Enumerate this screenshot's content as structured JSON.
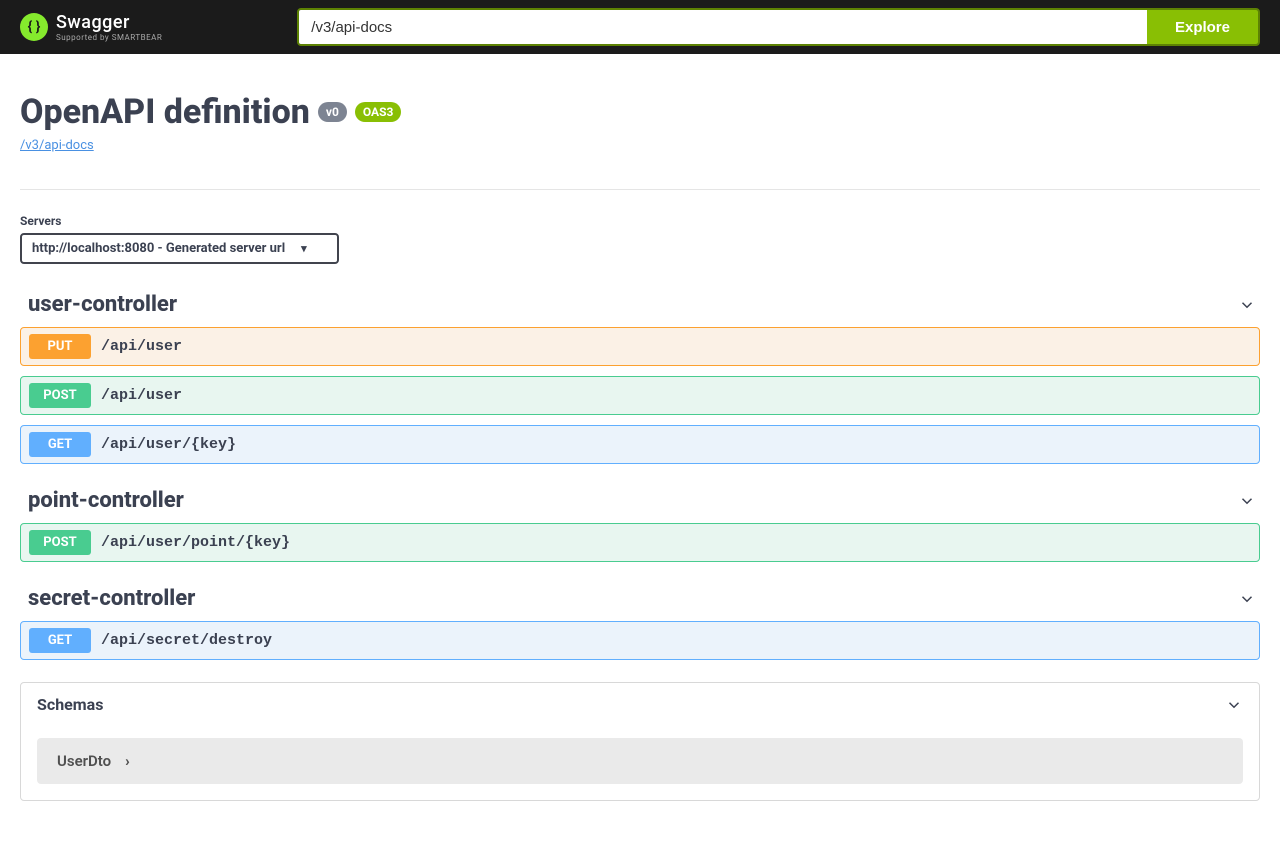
{
  "topbar": {
    "brand": "Swagger",
    "subbrand": "Supported by SMARTBEAR",
    "search_value": "/v3/api-docs",
    "explore_label": "Explore"
  },
  "header": {
    "title": "OpenAPI definition",
    "version_badge": "v0",
    "oas_badge": "OAS3",
    "docs_link": "/v3/api-docs"
  },
  "servers": {
    "label": "Servers",
    "selected": "http://localhost:8080 - Generated server url"
  },
  "tags": [
    {
      "name": "user-controller",
      "ops": [
        {
          "method": "PUT",
          "method_class": "put",
          "path": "/api/user"
        },
        {
          "method": "POST",
          "method_class": "post",
          "path": "/api/user"
        },
        {
          "method": "GET",
          "method_class": "get",
          "path": "/api/user/{key}"
        }
      ]
    },
    {
      "name": "point-controller",
      "ops": [
        {
          "method": "POST",
          "method_class": "post",
          "path": "/api/user/point/{key}"
        }
      ]
    },
    {
      "name": "secret-controller",
      "ops": [
        {
          "method": "GET",
          "method_class": "get",
          "path": "/api/secret/destroy"
        }
      ]
    }
  ],
  "schemas": {
    "title": "Schemas",
    "items": [
      "UserDto"
    ]
  }
}
